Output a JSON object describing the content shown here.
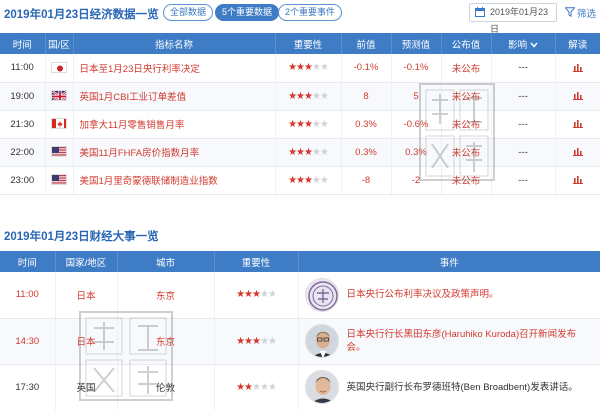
{
  "header": {
    "title": "2019年01月23日经济数据一览",
    "tabs": [
      {
        "label": "全部数据",
        "active": false
      },
      {
        "label": "5个重要数据",
        "active": true
      },
      {
        "label": "2个重要事件",
        "active": false
      }
    ],
    "date": "2019年01月23日",
    "filter_label": "筛选"
  },
  "data_table": {
    "columns": [
      "时间",
      "国/区",
      "指标名称",
      "重要性",
      "前值",
      "预测值",
      "公布值",
      "影响",
      "解读"
    ],
    "rows": [
      {
        "time": "11:00",
        "country": "Japan",
        "name": "日本至1月23日央行利率决定",
        "importance": 3,
        "previous": "-0.1%",
        "forecast": "-0.1%",
        "actual": "未公布",
        "impact": "---"
      },
      {
        "time": "19:00",
        "country": "UK",
        "name": "英国1月CBI工业订单差值",
        "importance": 3,
        "previous": "8",
        "forecast": "5",
        "actual": "未公布",
        "impact": "---"
      },
      {
        "time": "21:30",
        "country": "Canada",
        "name": "加拿大11月零售销售月率",
        "importance": 3,
        "previous": "0.3%",
        "forecast": "-0.6%",
        "actual": "未公布",
        "impact": "---"
      },
      {
        "time": "22:00",
        "country": "US",
        "name": "美国11月FHFA房价指数月率",
        "importance": 3,
        "previous": "0.3%",
        "forecast": "0.3%",
        "actual": "未公布",
        "impact": "---"
      },
      {
        "time": "23:00",
        "country": "US",
        "name": "美国1月里奇蒙德联储制造业指数",
        "importance": 3,
        "previous": "-8",
        "forecast": "-2",
        "actual": "未公布",
        "impact": "---"
      }
    ]
  },
  "events_section": {
    "title": "2019年01月23日财经大事一览",
    "columns": [
      "时间",
      "国家/地区",
      "城市",
      "重要性",
      "事件"
    ],
    "rows": [
      {
        "time": "11:00",
        "region": "日本",
        "city": "东京",
        "importance": 3,
        "event": "日本央行公布利率决议及政策声明。",
        "avatar": "boj-seal-icon"
      },
      {
        "time": "14:30",
        "region": "日本",
        "city": "东京",
        "importance": 3,
        "event": "日本央行行长黑田东彦(Haruhiko Kuroda)召开新闻发布会。",
        "avatar": "kuroda-portrait"
      },
      {
        "time": "17:30",
        "region": "英国",
        "city": "伦敦",
        "importance": 2,
        "event": "英国央行副行长布罗德班特(Ben Broadbent)发表讲话。",
        "avatar": "broadbent-portrait"
      }
    ]
  },
  "colors": {
    "accent": "#3f7cc6",
    "title": "#2a67b3",
    "red": "#d23a2f",
    "star_on": "#d6372b",
    "star_off": "#cfd3d8"
  },
  "star_max": 5
}
